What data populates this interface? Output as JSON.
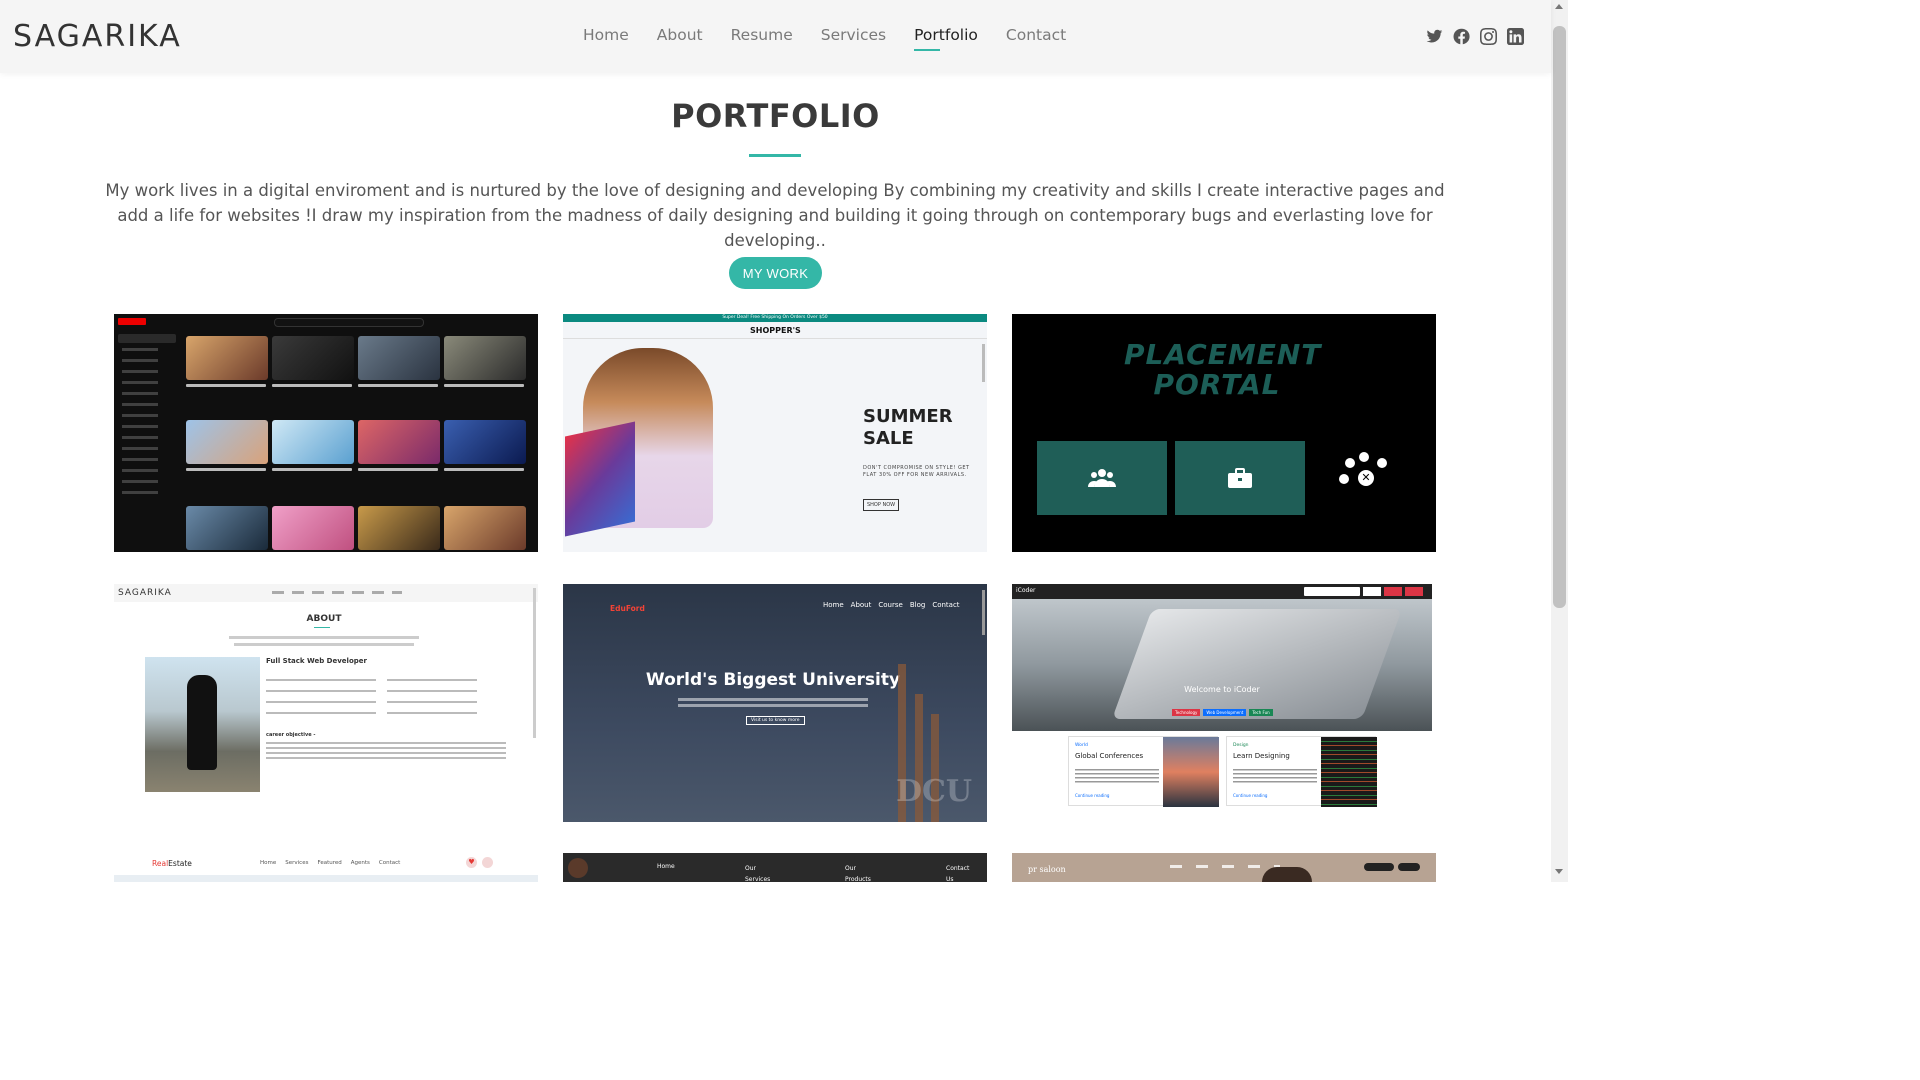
{
  "header": {
    "logo": "SAGARIKA",
    "nav": [
      "Home",
      "About",
      "Resume",
      "Services",
      "Portfolio",
      "Contact"
    ],
    "active_nav": "Portfolio",
    "social_icons": [
      "twitter-icon",
      "facebook-icon",
      "instagram-icon",
      "linkedin-icon"
    ]
  },
  "portfolio": {
    "title": "PORTFOLIO",
    "intro": "My work lives in a digital enviroment and is nurtured by the love of designing and developing By combining my creativity and skills I create interactive pages and add a life for websites !I draw my inspiration from the madness of daily designing and building it going through on contemporary bugs and everlasting love for developing..",
    "filter_label": "MY WORK",
    "accent_color": "#34b7a7"
  },
  "cards": {
    "shopper": {
      "banner": "Super Deal! Free Shipping On Orders Over $50",
      "brand": "SHOPPER'S",
      "headline": "SUMMER SALE",
      "sub": "DON'T COMPROMISE ON STYLE! GET FLAT 30% OFF FOR NEW ARRIVALS.",
      "cta": "SHOP NOW"
    },
    "placement": {
      "title": "PLACEMENT PORTAL"
    },
    "about": {
      "logo": "SAGARIKA",
      "heading": "ABOUT",
      "role": "Full Stack Web Developer",
      "objective": "career objective -"
    },
    "eduford": {
      "brand": "EduFord",
      "nav": [
        "Home",
        "About",
        "Course",
        "Blog",
        "Contact"
      ],
      "headline": "World's Biggest University",
      "cta": "Visit us to know more",
      "watermark": "DCU"
    },
    "icoder": {
      "brand": "iCoder",
      "hero": "Welcome to iCoder",
      "tags": [
        "Technology",
        "Web Development",
        "Tech Fun"
      ],
      "card1_cat": "World",
      "card1_title": "Global Conferences",
      "card2_cat": "Design",
      "card2_title": "Learn Designing",
      "link": "Continue reading"
    },
    "realestate": {
      "brand_red": "Real",
      "brand_dark": "Estate",
      "nav": [
        "Home",
        "Services",
        "Featured",
        "Agents",
        "Contact"
      ]
    },
    "row3_middle": {
      "nav": [
        "Home",
        "Our Services",
        "Our Products",
        "Contact Us"
      ]
    },
    "saloon": {
      "brand": "pr saloon"
    }
  }
}
